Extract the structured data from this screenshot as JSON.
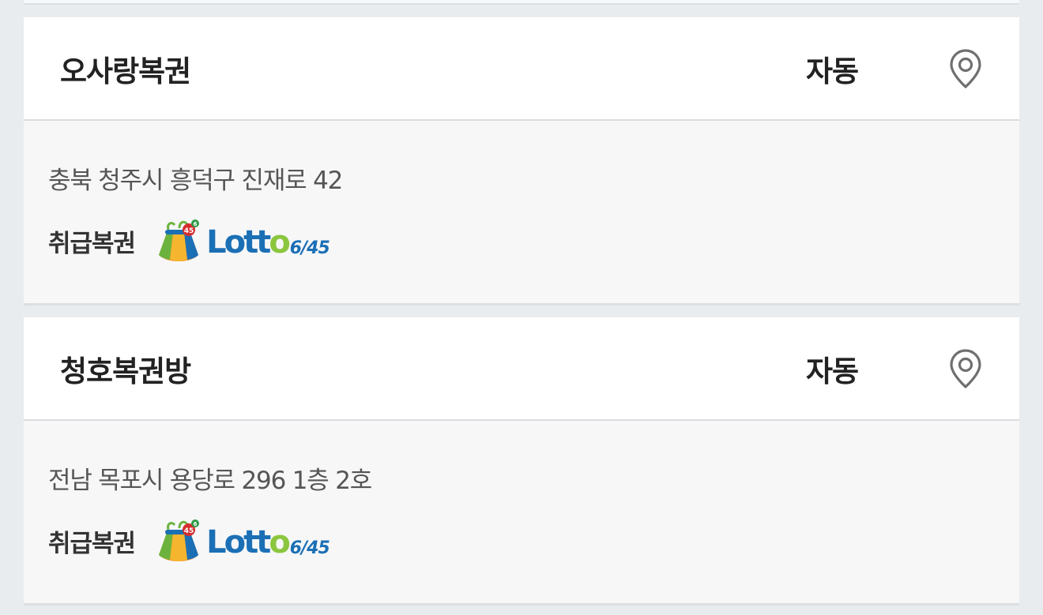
{
  "stores": [
    {
      "name": "오사랑복권",
      "pick_type": "자동",
      "address": "충북 청주시 흥덕구 진재로 42",
      "lottery_label": "취급복권",
      "lottery": {
        "brand": "Lotto",
        "brand_first": "Lott",
        "brand_last": "o",
        "suffix": "6/45",
        "icon": "lotto-bag-icon"
      },
      "map_icon": "map-pin-icon"
    },
    {
      "name": "청호복권방",
      "pick_type": "자동",
      "address": "전남 목포시 용당로 296 1층 2호",
      "lottery_label": "취급복권",
      "lottery": {
        "brand": "Lotto",
        "brand_first": "Lott",
        "brand_last": "o",
        "suffix": "6/45",
        "icon": "lotto-bag-icon"
      },
      "map_icon": "map-pin-icon"
    }
  ],
  "colors": {
    "page_bg": "#e9ecee",
    "card_head_bg": "#ffffff",
    "card_body_bg": "#f7f7f8",
    "lotto_blue": "#1b6fb5",
    "lotto_green": "#8cc63e"
  }
}
